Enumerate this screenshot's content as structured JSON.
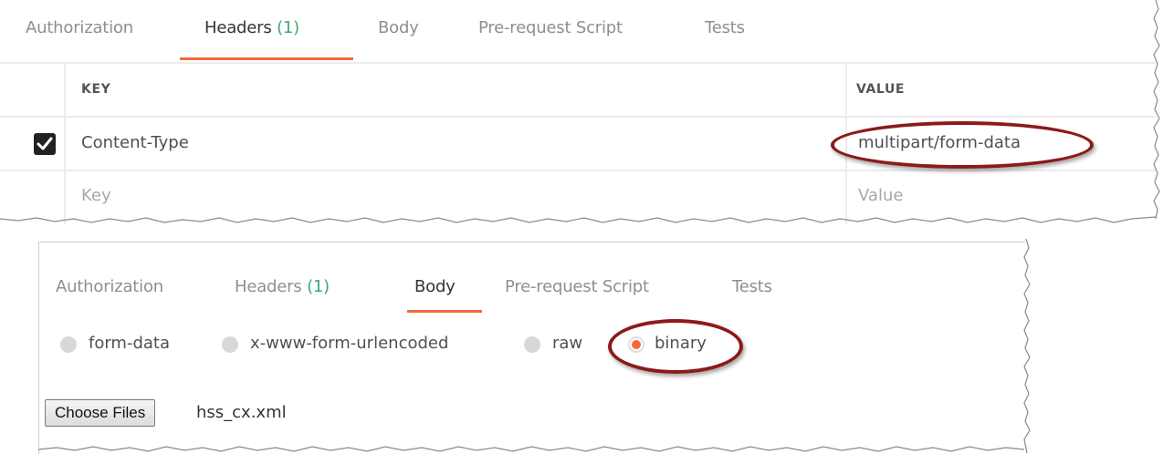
{
  "headers_panel": {
    "tabs": [
      {
        "label": "Authorization"
      },
      {
        "label": "Headers",
        "count": "(1)"
      },
      {
        "label": "Body"
      },
      {
        "label": "Pre-request Script"
      },
      {
        "label": "Tests"
      }
    ],
    "active_tab": "Headers",
    "columns": {
      "key": "KEY",
      "value": "VALUE"
    },
    "rows": [
      {
        "checked": true,
        "key": "Content-Type",
        "value": "multipart/form-data"
      }
    ],
    "new_row": {
      "key_placeholder": "Key",
      "value_placeholder": "Value"
    }
  },
  "body_panel": {
    "tabs": [
      {
        "label": "Authorization"
      },
      {
        "label": "Headers",
        "count": "(1)"
      },
      {
        "label": "Body"
      },
      {
        "label": "Pre-request Script"
      },
      {
        "label": "Tests"
      }
    ],
    "active_tab": "Body",
    "body_modes": [
      {
        "label": "form-data",
        "selected": false
      },
      {
        "label": "x-www-form-urlencoded",
        "selected": false
      },
      {
        "label": "raw",
        "selected": false
      },
      {
        "label": "binary",
        "selected": true
      }
    ],
    "file_button": "Choose Files",
    "file_name": "hss_cx.xml"
  },
  "colors": {
    "accent": "#f26b3a",
    "count_green": "#3fa670",
    "annotation": "#8b1a1a"
  }
}
